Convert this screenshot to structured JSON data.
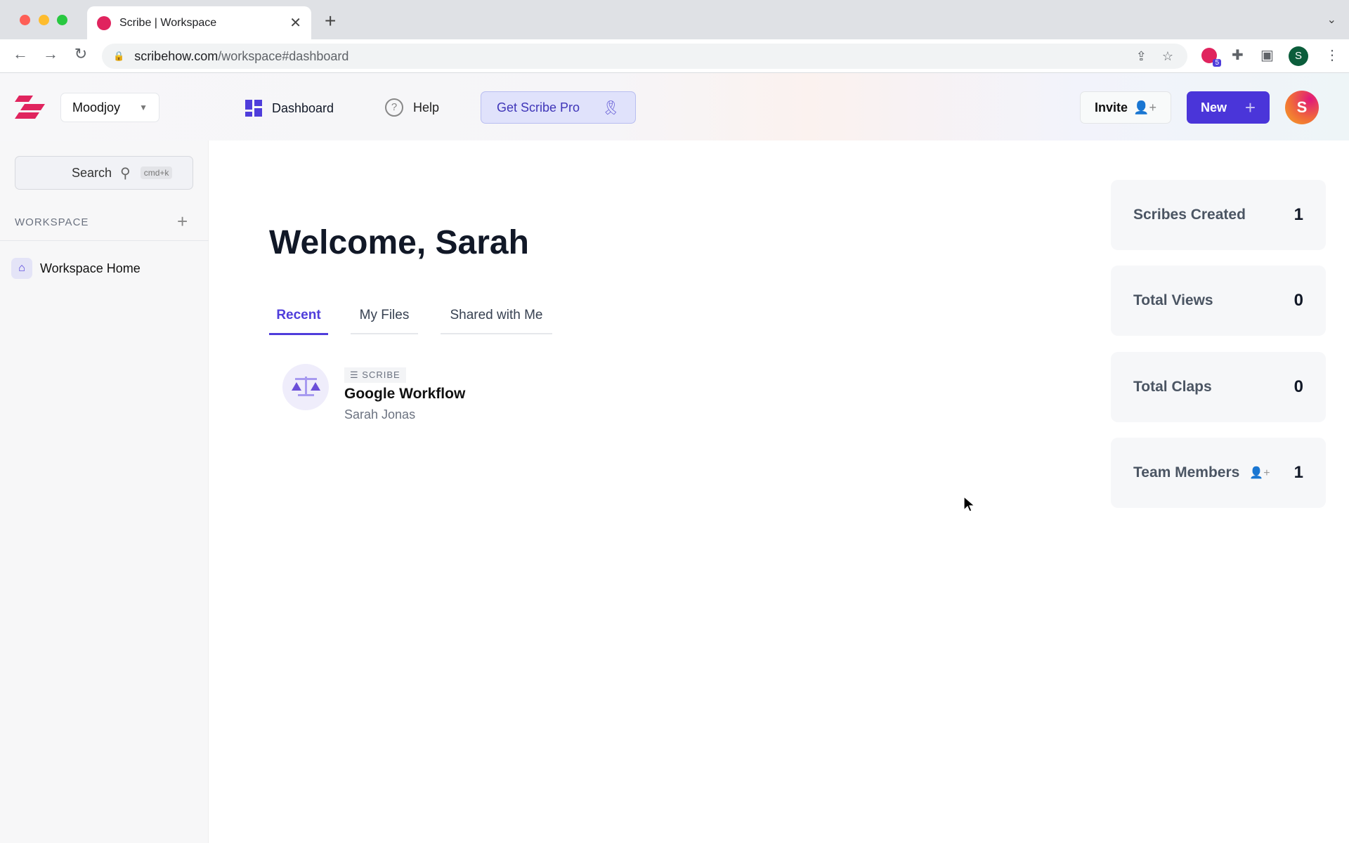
{
  "browser": {
    "tab_title": "Scribe | Workspace",
    "url_host": "scribehow.com",
    "url_path": "/workspace#dashboard",
    "extension_badge": "5",
    "profile_initial": "S"
  },
  "header": {
    "workspace_name": "Moodjoy",
    "dashboard": "Dashboard",
    "help": "Help",
    "get_pro": "Get Scribe Pro",
    "invite": "Invite",
    "new": "New",
    "avatar_initial": "S"
  },
  "sidebar": {
    "search_label": "Search",
    "search_shortcut": "cmd+k",
    "section_label": "WORKSPACE",
    "items": [
      {
        "label": "Workspace Home"
      }
    ]
  },
  "main": {
    "welcome": "Welcome, Sarah",
    "tabs": [
      {
        "label": "Recent",
        "active": true
      },
      {
        "label": "My Files"
      },
      {
        "label": "Shared with Me"
      }
    ],
    "files": [
      {
        "type": "SCRIBE",
        "title": "Google Workflow",
        "author": "Sarah Jonas"
      }
    ]
  },
  "stats": [
    {
      "label": "Scribes Created",
      "value": "1"
    },
    {
      "label": "Total Views",
      "value": "0"
    },
    {
      "label": "Total Claps",
      "value": "0"
    },
    {
      "label": "Team Members",
      "value": "1"
    }
  ],
  "colors": {
    "accent": "#4f3ddb",
    "brand": "#e0245e"
  }
}
